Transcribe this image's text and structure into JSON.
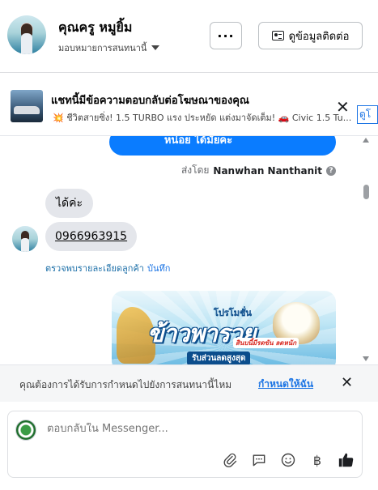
{
  "header": {
    "contact_name": "คุณครู หมูยิ้ม",
    "assign_label": "มอบหมายการสนทนานี้",
    "more_label": "···",
    "contact_info_label": "ดูข้อมูลติดต่อ"
  },
  "ad_banner": {
    "title": "แชทนี้มีข้อความตอบกลับต่อโฆษณาของคุณ",
    "subtitle": "💥 ชีวิตสายซิ่ง! 1.5 TURBO แรง ประหยัด แต่งมาจัดเต็ม! 🚗 Civic 1.5 Tu...",
    "link_label": "ดูโ"
  },
  "conversation": {
    "outgoing_partial": "หน่อย ได้มัยคะ",
    "sent_by_prefix": "ส่งโดย",
    "sent_by_name": "Nanwhan Nanthanit",
    "incoming_1": "ได้ค่ะ",
    "incoming_2": "0966963915",
    "verify_text": "ตรวจพบรายละเอียดลูกค้า",
    "verify_action": "บันทึก",
    "promo": {
      "small_text": "โปรโมชั่น",
      "big_text": "ข้าวพารวย",
      "tag_text": "สินบนี้มีรดขัน ลดหนัก",
      "strip_text": "รับส่วนลดสูงสุด"
    }
  },
  "assign_prompt": {
    "text": "คุณต้องการได้รับการกำหนดไปยังการสนทนานี้ไหม",
    "link": "กำหนดให้ฉัน"
  },
  "composer": {
    "placeholder": "ตอบกลับใน Messenger...",
    "tools": [
      "paperclip-icon",
      "chat-bubble-icon",
      "emoji-icon",
      "baht-icon",
      "thumbs-up-icon"
    ]
  },
  "colors": {
    "accent": "#1b74e4",
    "outgoing_bubble": "#0a7cff",
    "incoming_bubble": "#e4e6eb"
  }
}
